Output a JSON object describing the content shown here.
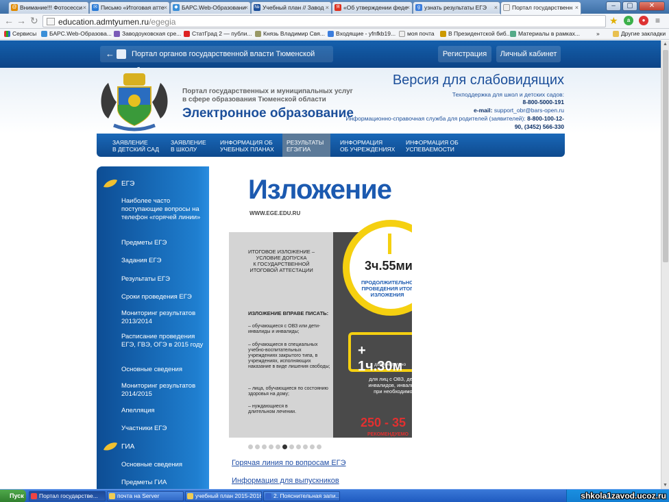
{
  "tabs": [
    {
      "label": "Внимание!!! Фотосесси",
      "icon": "email-icon",
      "active": false
    },
    {
      "label": "Письмо «Итоговая атте",
      "icon": "mail-icon",
      "active": false
    },
    {
      "label": "БАРС.Web-Образовани",
      "icon": "bars-icon",
      "active": false
    },
    {
      "label": "Учебный план // Завод",
      "icon": "doc-icon",
      "active": false
    },
    {
      "label": "«Об утверждении феде",
      "icon": "yandex-icon",
      "active": false
    },
    {
      "label": "узнать результаты ЕГЭ",
      "icon": "google-icon",
      "active": false
    },
    {
      "label": "Портал государственн",
      "icon": "page-icon",
      "active": true
    }
  ],
  "address": {
    "host": "education.admtyumen.ru",
    "path": "/egegia"
  },
  "bookmarks": [
    "Сервисы",
    "БАРС.Web-Образова...",
    "Заводоуковская сре...",
    "СтатГрад 2 — публи...",
    "Князь Владимир Свя...",
    "Входящие - yfnfkb19...",
    "моя почта",
    "В Президентской биб...",
    "Материалы в рамках...",
    "»",
    "Другие закладки"
  ],
  "portal": {
    "link_label": "Портал органов государственной власти Тюменской области",
    "register_label": "Регистрация",
    "cabinet_label": "Личный кабинет"
  },
  "header": {
    "subtitle_line1": "Портал государственных и муниципальных услуг",
    "subtitle_line2": "в сфере образования Тюменской области",
    "title": "Электронное образование",
    "low_vision": "Версия для слабовидящих",
    "support_label": "Техподдержка для школ и детских садов:",
    "support_phone": "8-800-5000-191",
    "email_label": "e-mail:",
    "email": "support_obr@bars-open.ru",
    "info_label": "Информационно-справочная служба для родителей (заявителей):",
    "info_phone1": "8-800-100-12-",
    "info_phone2": "90, (3452) 566-330"
  },
  "menu": [
    {
      "line1": "Заявление",
      "line2": "в детский сад",
      "active": false
    },
    {
      "line1": "Заявление",
      "line2": "в школу",
      "active": false
    },
    {
      "line1": "Информация об",
      "line2": "учебных планах",
      "active": false
    },
    {
      "line1": "Результаты",
      "line2": "ЕГЭ/ГИА",
      "active": true
    },
    {
      "line1": "Информация",
      "line2": "об учреждениях",
      "active": false
    },
    {
      "line1": "Информация об",
      "line2": "успеваемости",
      "active": false
    }
  ],
  "sidebar": {
    "ege_title": "ЕГЭ",
    "ege_items": [
      "Наиболее часто поступающие вопросы на телефон «горячей линии»",
      "Предметы ЕГЭ",
      "Задания ЕГЭ",
      "Результаты ЕГЭ",
      "Сроки проведения ЕГЭ",
      "Мониторинг результатов 2013/2014",
      "Расписание проведения ЕГЭ, ГВЭ, ОГЭ в 2015 году",
      "Основные сведения",
      "Мониторинг результатов 2014/2015",
      "Апелляция",
      "Участники ЕГЭ"
    ],
    "gia_title": "ГИА",
    "gia_items": [
      "Основные сведения",
      "Предметы ГИА"
    ]
  },
  "slide": {
    "title": "Изложение",
    "url": "WWW.EGE.EDU.RU",
    "box_title_1": "ИТОГОВОЕ ИЗЛОЖЕНИЕ –",
    "box_title_2": "УСЛОВИЕ ДОПУСКА",
    "box_title_3": "К ГОСУДАРСТВЕННОЙ",
    "box_title_4": "ИТОГОВОЙ АТТЕСТАЦИИ",
    "write_title": "ИЗЛОЖЕНИЕ ВПРАВЕ ПИСАТЬ:",
    "items": [
      "– обучающиеся с ОВЗ или дети-инвалиды и инвалиды;",
      "– обучающиеся в специальных учебно-воспитательных учреждениях закрытого типа, в учреждениях, исполняющих наказание в виде лишения свободы;",
      "– лица, обучающиеся по состоянию здоровья на дому;",
      "– нуждающиеся в длительном лечении."
    ],
    "time": "3ч.55ми",
    "time_label": "ПРОДОЛЖИТЕЛЬНО ПРОВЕДЕНИЯ ИТОГ ИЗЛОЖЕНИЯ",
    "extra_time": "+ 1ч.30м",
    "extra_label": "дополнительно",
    "extra_note": "для лиц с ОВЗ, детей-инвалидов, инвалидов при необходимост",
    "words": "250 - 35",
    "words_label": "РЕКОМЕНДУЕМО"
  },
  "slider": {
    "count": 11,
    "active": 5
  },
  "links": [
    "Горячая линия по вопросам ЕГЭ",
    "Информация для выпускников"
  ],
  "taskbar": {
    "start": "Пуск",
    "tasks": [
      {
        "label": "Портал государстве...",
        "active": true
      },
      {
        "label": "почта на Server",
        "active": false
      },
      {
        "label": "учебный план 2015-2016",
        "active": false
      },
      {
        "label": "2. Пояснительная запи...",
        "active": false
      }
    ],
    "watermark": "shkola1zavod.ucoz.ru"
  }
}
